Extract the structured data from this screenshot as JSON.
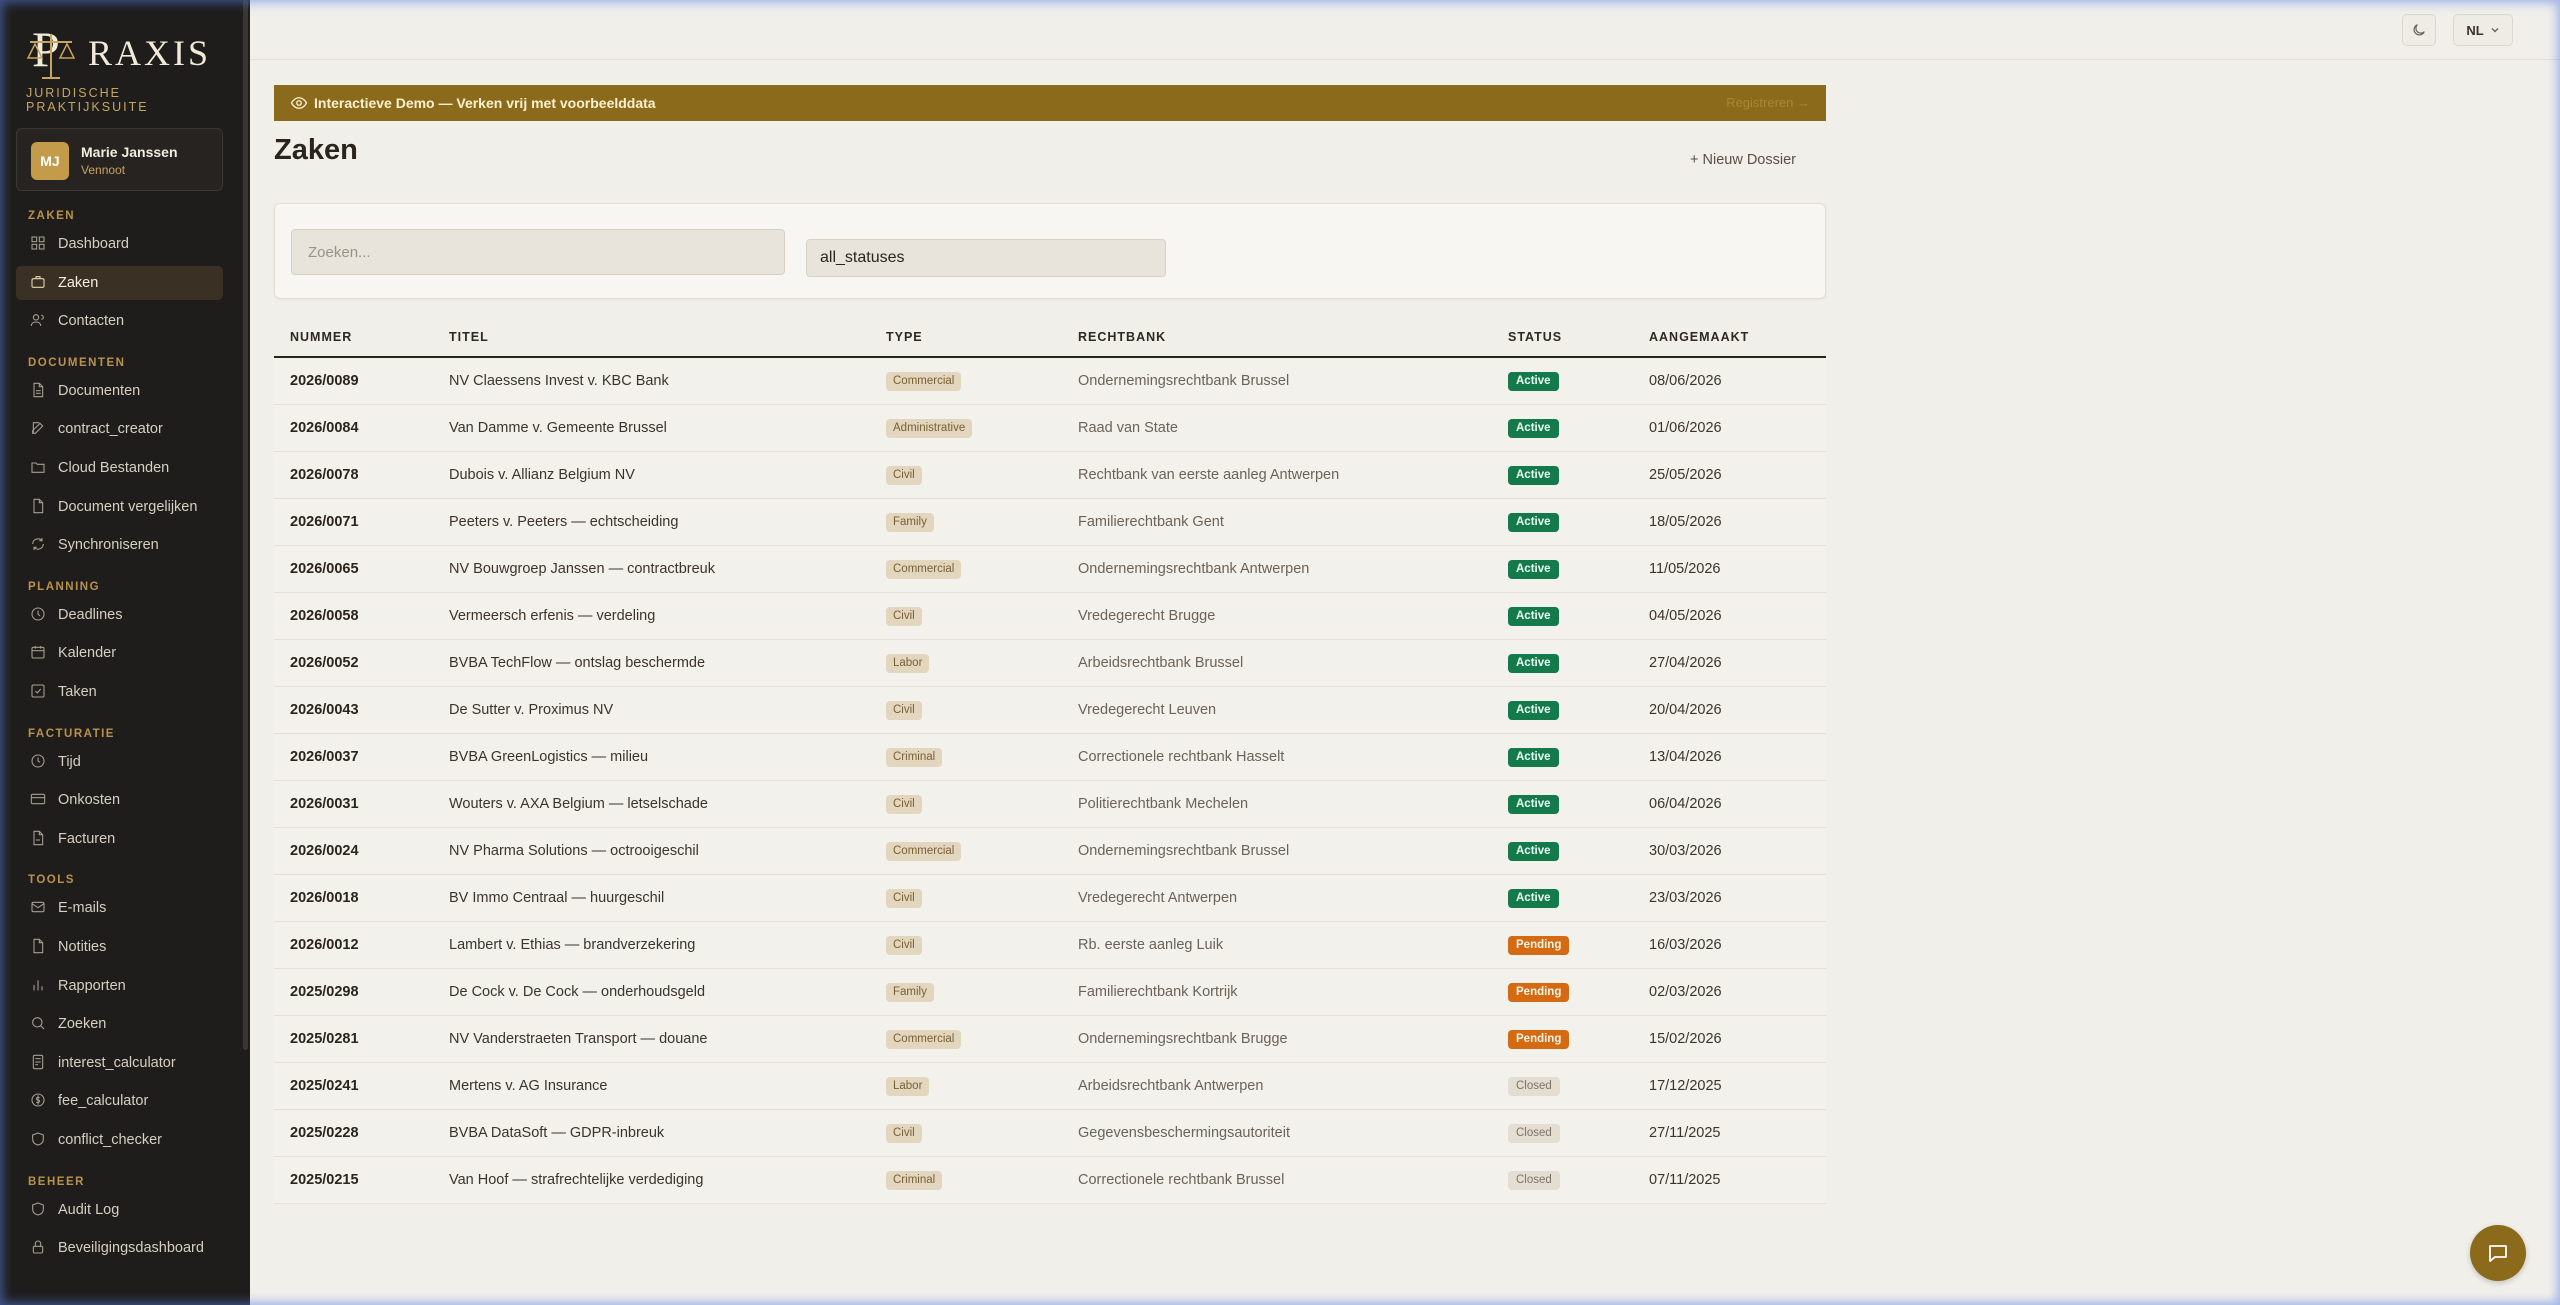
{
  "brand": {
    "name": "RAXIS",
    "initial": "P",
    "subtitle": "JURIDISCHE PRAKTIJKSUITE"
  },
  "user": {
    "initials": "MJ",
    "name": "Marie Janssen",
    "role": "Vennoot"
  },
  "sidebar": {
    "sections": [
      {
        "label": "ZAKEN",
        "items": [
          {
            "label": "Dashboard",
            "icon": "dashboard-icon"
          },
          {
            "label": "Zaken",
            "icon": "briefcase-icon",
            "active": true
          },
          {
            "label": "Contacten",
            "icon": "contacts-icon"
          }
        ]
      },
      {
        "label": "DOCUMENTEN",
        "items": [
          {
            "label": "Documenten",
            "icon": "document-icon"
          },
          {
            "label": "contract_creator",
            "icon": "edit-icon"
          },
          {
            "label": "Cloud Bestanden",
            "icon": "folder-icon"
          },
          {
            "label": "Document vergelijken",
            "icon": "compare-icon"
          },
          {
            "label": "Synchroniseren",
            "icon": "sync-icon"
          }
        ]
      },
      {
        "label": "PLANNING",
        "items": [
          {
            "label": "Deadlines",
            "icon": "clock-icon"
          },
          {
            "label": "Kalender",
            "icon": "calendar-icon"
          },
          {
            "label": "Taken",
            "icon": "task-icon"
          }
        ]
      },
      {
        "label": "FACTURATIE",
        "items": [
          {
            "label": "Tijd",
            "icon": "timer-icon"
          },
          {
            "label": "Onkosten",
            "icon": "card-icon"
          },
          {
            "label": "Facturen",
            "icon": "invoice-icon"
          }
        ]
      },
      {
        "label": "TOOLS",
        "items": [
          {
            "label": "E-mails",
            "icon": "mail-icon"
          },
          {
            "label": "Notities",
            "icon": "note-icon"
          },
          {
            "label": "Rapporten",
            "icon": "chart-icon"
          },
          {
            "label": "Zoeken",
            "icon": "search-icon"
          },
          {
            "label": "interest_calculator",
            "icon": "calculator-icon"
          },
          {
            "label": "fee_calculator",
            "icon": "coin-icon"
          },
          {
            "label": "conflict_checker",
            "icon": "shield-icon"
          }
        ]
      },
      {
        "label": "BEHEER",
        "items": [
          {
            "label": "Audit Log",
            "icon": "shield-icon"
          },
          {
            "label": "Beveiligingsdashboard",
            "icon": "lock-icon"
          }
        ]
      }
    ]
  },
  "topbar": {
    "lang": "NL"
  },
  "banner": {
    "text": "Interactieve Demo — Verken vrij met voorbeelddata",
    "link": "Registreren →"
  },
  "page": {
    "title": "Zaken",
    "new_button": "+ Nieuw Dossier"
  },
  "filters": {
    "search_placeholder": "Zoeken...",
    "status_value": "all_statuses"
  },
  "table": {
    "headers": [
      "NUMMER",
      "TITEL",
      "TYPE",
      "RECHTBANK",
      "STATUS",
      "AANGEMAAKT"
    ],
    "rows": [
      {
        "number": "2026/0089",
        "title": "NV Claessens Invest v. KBC Bank",
        "type": "Commercial",
        "court": "Ondernemingsrechtbank Brussel",
        "status": "Active",
        "created": "08/06/2026"
      },
      {
        "number": "2026/0084",
        "title": "Van Damme v. Gemeente Brussel",
        "type": "Administrative",
        "court": "Raad van State",
        "status": "Active",
        "created": "01/06/2026"
      },
      {
        "number": "2026/0078",
        "title": "Dubois v. Allianz Belgium NV",
        "type": "Civil",
        "court": "Rechtbank van eerste aanleg Antwerpen",
        "status": "Active",
        "created": "25/05/2026"
      },
      {
        "number": "2026/0071",
        "title": "Peeters v. Peeters — echtscheiding",
        "type": "Family",
        "court": "Familierechtbank Gent",
        "status": "Active",
        "created": "18/05/2026"
      },
      {
        "number": "2026/0065",
        "title": "NV Bouwgroep Janssen — contractbreuk",
        "type": "Commercial",
        "court": "Ondernemingsrechtbank Antwerpen",
        "status": "Active",
        "created": "11/05/2026"
      },
      {
        "number": "2026/0058",
        "title": "Vermeersch erfenis — verdeling",
        "type": "Civil",
        "court": "Vredegerecht Brugge",
        "status": "Active",
        "created": "04/05/2026"
      },
      {
        "number": "2026/0052",
        "title": "BVBA TechFlow — ontslag beschermde",
        "type": "Labor",
        "court": "Arbeidsrechtbank Brussel",
        "status": "Active",
        "created": "27/04/2026"
      },
      {
        "number": "2026/0043",
        "title": "De Sutter v. Proximus NV",
        "type": "Civil",
        "court": "Vredegerecht Leuven",
        "status": "Active",
        "created": "20/04/2026"
      },
      {
        "number": "2026/0037",
        "title": "BVBA GreenLogistics — milieu",
        "type": "Criminal",
        "court": "Correctionele rechtbank Hasselt",
        "status": "Active",
        "created": "13/04/2026"
      },
      {
        "number": "2026/0031",
        "title": "Wouters v. AXA Belgium — letselschade",
        "type": "Civil",
        "court": "Politierechtbank Mechelen",
        "status": "Active",
        "created": "06/04/2026"
      },
      {
        "number": "2026/0024",
        "title": "NV Pharma Solutions — octrooigeschil",
        "type": "Commercial",
        "court": "Ondernemingsrechtbank Brussel",
        "status": "Active",
        "created": "30/03/2026"
      },
      {
        "number": "2026/0018",
        "title": "BV Immo Centraal — huurgeschil",
        "type": "Civil",
        "court": "Vredegerecht Antwerpen",
        "status": "Active",
        "created": "23/03/2026"
      },
      {
        "number": "2026/0012",
        "title": "Lambert v. Ethias — brandverzekering",
        "type": "Civil",
        "court": "Rb. eerste aanleg Luik",
        "status": "Pending",
        "created": "16/03/2026"
      },
      {
        "number": "2025/0298",
        "title": "De Cock v. De Cock — onderhoudsgeld",
        "type": "Family",
        "court": "Familierechtbank Kortrijk",
        "status": "Pending",
        "created": "02/03/2026"
      },
      {
        "number": "2025/0281",
        "title": "NV Vanderstraeten Transport — douane",
        "type": "Commercial",
        "court": "Ondernemingsrechtbank Brugge",
        "status": "Pending",
        "created": "15/02/2026"
      },
      {
        "number": "2025/0241",
        "title": "Mertens v. AG Insurance",
        "type": "Labor",
        "court": "Arbeidsrechtbank Antwerpen",
        "status": "Closed",
        "created": "17/12/2025"
      },
      {
        "number": "2025/0228",
        "title": "BVBA DataSoft — GDPR-inbreuk",
        "type": "Civil",
        "court": "Gegevensbeschermingsautoriteit",
        "status": "Closed",
        "created": "27/11/2025"
      },
      {
        "number": "2025/0215",
        "title": "Van Hoof — strafrechtelijke verdediging",
        "type": "Criminal",
        "court": "Correctionele rechtbank Brussel",
        "status": "Closed",
        "created": "07/11/2025"
      }
    ]
  }
}
